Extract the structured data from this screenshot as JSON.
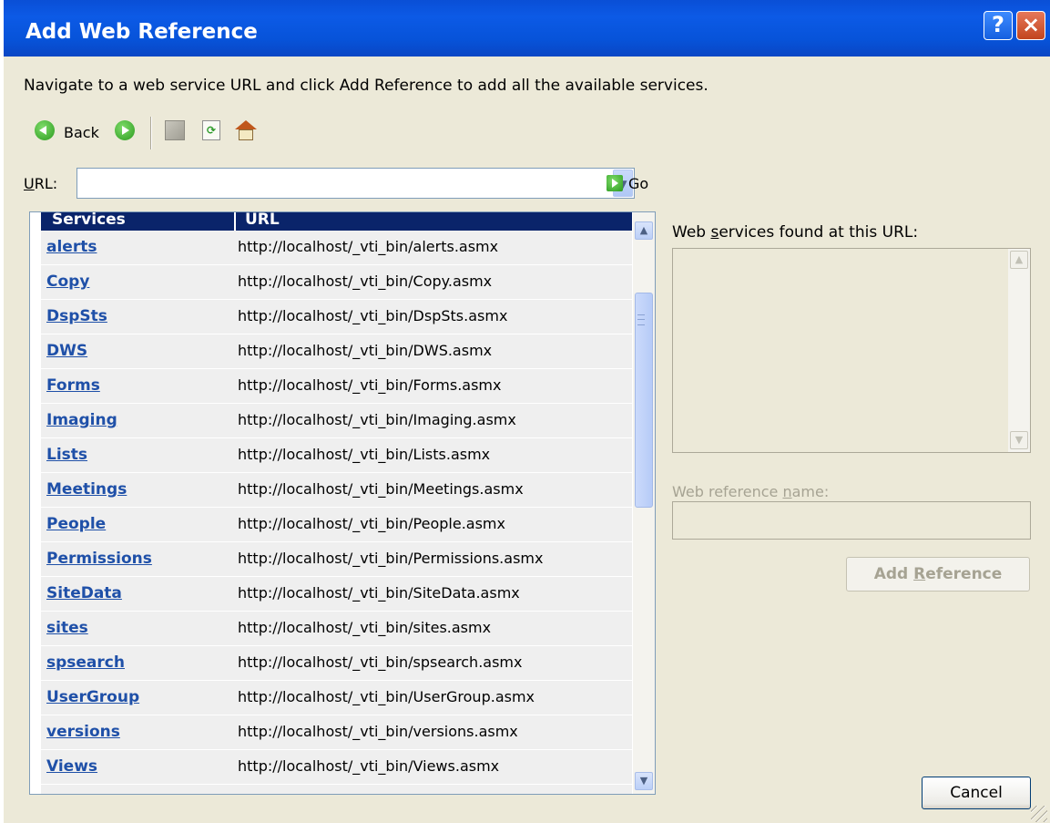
{
  "dialog": {
    "title": "Add Web Reference",
    "help_glyph": "?",
    "close_glyph": "×",
    "instructions": "Navigate to a web service URL and click Add Reference to add all the available services."
  },
  "toolbar": {
    "back_label": "Back",
    "icons": [
      "back-arrow-icon",
      "forward-arrow-icon",
      "stop-icon",
      "refresh-icon",
      "home-icon"
    ]
  },
  "url_bar": {
    "label_accel": "U",
    "label_rest": "RL:",
    "value": "",
    "go_label": "Go",
    "dropdown_glyph": "▼"
  },
  "services_table": {
    "headers": [
      "Services",
      "URL"
    ],
    "rows": [
      {
        "name": "alerts",
        "url": "http://localhost/_vti_bin/alerts.asmx"
      },
      {
        "name": "Copy",
        "url": "http://localhost/_vti_bin/Copy.asmx"
      },
      {
        "name": "DspSts",
        "url": "http://localhost/_vti_bin/DspSts.asmx"
      },
      {
        "name": "DWS",
        "url": "http://localhost/_vti_bin/DWS.asmx"
      },
      {
        "name": "Forms",
        "url": "http://localhost/_vti_bin/Forms.asmx"
      },
      {
        "name": "Imaging",
        "url": "http://localhost/_vti_bin/Imaging.asmx"
      },
      {
        "name": "Lists",
        "url": "http://localhost/_vti_bin/Lists.asmx"
      },
      {
        "name": "Meetings",
        "url": "http://localhost/_vti_bin/Meetings.asmx"
      },
      {
        "name": "People",
        "url": "http://localhost/_vti_bin/People.asmx"
      },
      {
        "name": "Permissions",
        "url": "http://localhost/_vti_bin/Permissions.asmx"
      },
      {
        "name": "SiteData",
        "url": "http://localhost/_vti_bin/SiteData.asmx"
      },
      {
        "name": "sites",
        "url": "http://localhost/_vti_bin/sites.asmx"
      },
      {
        "name": "spsearch",
        "url": "http://localhost/_vti_bin/spsearch.asmx"
      },
      {
        "name": "UserGroup",
        "url": "http://localhost/_vti_bin/UserGroup.asmx"
      },
      {
        "name": "versions",
        "url": "http://localhost/_vti_bin/versions.asmx"
      },
      {
        "name": "Views",
        "url": "http://localhost/_vti_bin/Views.asmx"
      }
    ]
  },
  "right_panel": {
    "found_label_pre": "Web ",
    "found_label_accel": "s",
    "found_label_post": "ervices found at this URL:",
    "refname_label_pre": "Web reference ",
    "refname_label_accel": "n",
    "refname_label_post": "ame:",
    "refname_value": "",
    "add_ref_pre": "Add ",
    "add_ref_accel": "R",
    "add_ref_post": "eference",
    "cancel_label": "Cancel"
  },
  "colors": {
    "titlebar": "#0a4fd6",
    "dialog_bg": "#ece9d8",
    "header_bg": "#0a246a",
    "link": "#1f50a8",
    "disabled_text": "#a6a393"
  }
}
